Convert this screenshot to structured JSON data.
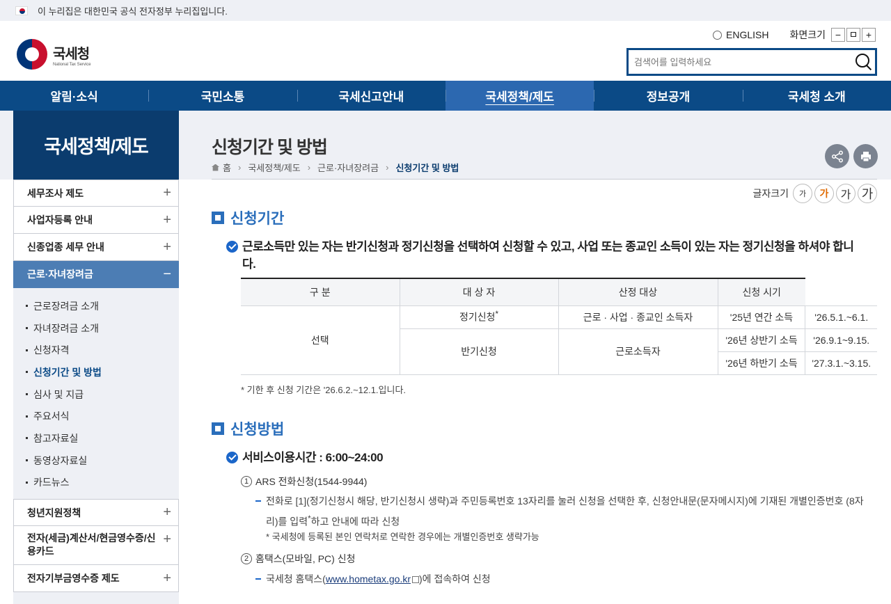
{
  "gov_banner": "이 누리집은 대한민국 공식 전자정부 누리집입니다.",
  "logo": {
    "ko": "국세청",
    "en": "National Tax Service"
  },
  "util": {
    "english": "ENGLISH",
    "zoom_label": "화면크기",
    "zoom_out": "−",
    "zoom_reset": "ㅁ",
    "zoom_in": "+"
  },
  "search": {
    "placeholder": "검색어를 입력하세요"
  },
  "gnb": [
    "알림·소식",
    "국민소통",
    "국세신고안내",
    "국세정책/제도",
    "정보공개",
    "국세청 소개"
  ],
  "lnb": {
    "title": "국세정책/제도",
    "top_items": [
      "세무조사 제도",
      "사업자등록 안내",
      "신종업종 세무 안내"
    ],
    "active": "근로·자녀장려금",
    "subs": [
      "근로장려금 소개",
      "자녀장려금 소개",
      "신청자격",
      "신청기간 및 방법",
      "심사 및 지급",
      "주요서식",
      "참고자료실",
      "동영상자료실",
      "카드뉴스"
    ],
    "bottom_items": [
      "청년지원정책",
      "전자(세금)계산서/현금영수증/신용카드",
      "전자기부금영수증 제도"
    ],
    "plus": "+",
    "minus": "−"
  },
  "page": {
    "title": "신청기간 및 방법",
    "breadcrumb": [
      "홈",
      "국세정책/제도",
      "근로·자녀장려금",
      "신청기간 및 방법"
    ],
    "share_icon": "share-icon",
    "print_icon": "print-icon"
  },
  "fontsize": {
    "label": "글자크기",
    "b1": "가",
    "b2": "가",
    "b3": "가",
    "b4": "가"
  },
  "sec1": {
    "title": "신청기간",
    "h3": "근로소득만 있는 자는 반기신청과 정기신청을 선택하여 신청할 수 있고, 사업 또는 종교인 소득이 있는 자는 정기신청을 하셔야 합니다.",
    "table": {
      "headers": [
        "구 분",
        "대 상 자",
        "산정 대상",
        "신청 시기"
      ],
      "group": "선택",
      "r1": {
        "type": "정기신청",
        "sup": "*",
        "target": "근로 · 사업 · 종교인 소득자",
        "basis": "'25년 연간 소득",
        "period": "'26.5.1.~6.1."
      },
      "r2": {
        "type": "반기신청",
        "target": "근로소득자",
        "basis": "'26년 상반기 소득",
        "period": "'26.9.1~9.15."
      },
      "r3": {
        "basis": "'26년 하반기 소득",
        "period": "'27.3.1.~3.15."
      }
    },
    "note": "* 기한 후 신청 기간은 '26.6.2.~12.1.입니다."
  },
  "sec2": {
    "title": "신청방법",
    "h3": "서비스이용시간 : 6:00~24:00",
    "m1": {
      "no": "1",
      "label": "ARS 전화신청(1544-9944)",
      "desc_a": "전화로 [1](정기신청시 해당, 반기신청시 생략)과 주민등록번호 13자리를 눌러 신청을 선택한 후, 신청안내문(문자메시지)에 기재된 개별인증번호 (8자리)를 입력",
      "desc_sup": "*",
      "desc_b": "하고 안내에 따라 신청",
      "note": "* 국세청에 등록된 본인 연락처로 연락한 경우에는 개별인증번호 생략가능"
    },
    "m2": {
      "no": "2",
      "label": "홈택스(모바일, PC) 신청",
      "desc_a": "국세청 홈택스(",
      "link": "www.hometax.go.kr",
      "desc_b": ")에 접속하여 신청"
    }
  }
}
